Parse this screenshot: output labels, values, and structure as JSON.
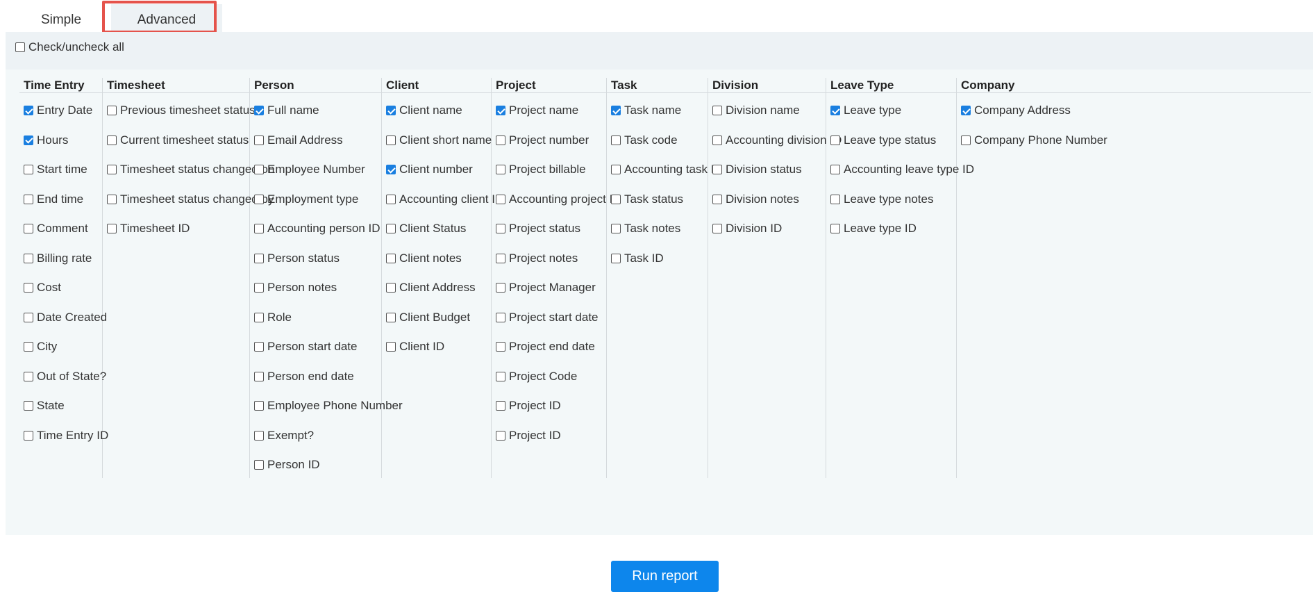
{
  "tabs": {
    "simple": "Simple",
    "advanced": "Advanced"
  },
  "check_all": "Check/uncheck all",
  "columns": [
    {
      "title": "Time Entry",
      "items": [
        {
          "label": "Entry Date",
          "checked": true
        },
        {
          "label": "Hours",
          "checked": true
        },
        {
          "label": "Start time",
          "checked": false
        },
        {
          "label": "End time",
          "checked": false
        },
        {
          "label": "Comment",
          "checked": false
        },
        {
          "label": "Billing rate",
          "checked": false
        },
        {
          "label": "Cost",
          "checked": false
        },
        {
          "label": "Date Created",
          "checked": false
        },
        {
          "label": "City",
          "checked": false
        },
        {
          "label": "Out of State?",
          "checked": false
        },
        {
          "label": "State",
          "checked": false
        },
        {
          "label": "Time Entry ID",
          "checked": false
        }
      ]
    },
    {
      "title": "Timesheet",
      "items": [
        {
          "label": "Previous timesheet status",
          "checked": false
        },
        {
          "label": "Current timesheet status",
          "checked": false
        },
        {
          "label": "Timesheet status changed on",
          "checked": false
        },
        {
          "label": "Timesheet status changed by",
          "checked": false
        },
        {
          "label": "Timesheet ID",
          "checked": false
        }
      ]
    },
    {
      "title": "Person",
      "items": [
        {
          "label": "Full name",
          "checked": true
        },
        {
          "label": "Email Address",
          "checked": false
        },
        {
          "label": "Employee Number",
          "checked": false
        },
        {
          "label": "Employment type",
          "checked": false
        },
        {
          "label": "Accounting person ID",
          "checked": false
        },
        {
          "label": "Person status",
          "checked": false
        },
        {
          "label": "Person notes",
          "checked": false
        },
        {
          "label": "Role",
          "checked": false
        },
        {
          "label": "Person start date",
          "checked": false
        },
        {
          "label": "Person end date",
          "checked": false
        },
        {
          "label": "Employee Phone Number",
          "checked": false
        },
        {
          "label": "Exempt?",
          "checked": false
        },
        {
          "label": "Person ID",
          "checked": false
        }
      ]
    },
    {
      "title": "Client",
      "items": [
        {
          "label": "Client name",
          "checked": true
        },
        {
          "label": "Client short name",
          "checked": false
        },
        {
          "label": "Client number",
          "checked": true
        },
        {
          "label": "Accounting client ID",
          "checked": false
        },
        {
          "label": "Client Status",
          "checked": false
        },
        {
          "label": "Client notes",
          "checked": false
        },
        {
          "label": "Client Address",
          "checked": false
        },
        {
          "label": "Client Budget",
          "checked": false
        },
        {
          "label": "Client ID",
          "checked": false
        }
      ]
    },
    {
      "title": "Project",
      "items": [
        {
          "label": "Project name",
          "checked": true
        },
        {
          "label": "Project number",
          "checked": false
        },
        {
          "label": "Project billable",
          "checked": false
        },
        {
          "label": "Accounting project ID",
          "checked": false
        },
        {
          "label": "Project status",
          "checked": false
        },
        {
          "label": "Project notes",
          "checked": false
        },
        {
          "label": "Project Manager",
          "checked": false
        },
        {
          "label": "Project start date",
          "checked": false
        },
        {
          "label": "Project end date",
          "checked": false
        },
        {
          "label": "Project Code",
          "checked": false
        },
        {
          "label": "Project ID",
          "checked": false
        },
        {
          "label": "Project ID",
          "checked": false
        }
      ]
    },
    {
      "title": "Task",
      "items": [
        {
          "label": "Task name",
          "checked": true
        },
        {
          "label": "Task code",
          "checked": false
        },
        {
          "label": "Accounting task ID",
          "checked": false
        },
        {
          "label": "Task status",
          "checked": false
        },
        {
          "label": "Task notes",
          "checked": false
        },
        {
          "label": "Task ID",
          "checked": false
        }
      ]
    },
    {
      "title": "Division",
      "items": [
        {
          "label": "Division name",
          "checked": false
        },
        {
          "label": "Accounting division ID",
          "checked": false
        },
        {
          "label": "Division status",
          "checked": false
        },
        {
          "label": "Division notes",
          "checked": false
        },
        {
          "label": "Division ID",
          "checked": false
        }
      ]
    },
    {
      "title": "Leave Type",
      "items": [
        {
          "label": "Leave type",
          "checked": true
        },
        {
          "label": "Leave type status",
          "checked": false
        },
        {
          "label": "Accounting leave type ID",
          "checked": false
        },
        {
          "label": "Leave type notes",
          "checked": false
        },
        {
          "label": "Leave type ID",
          "checked": false
        }
      ]
    },
    {
      "title": "Company",
      "items": [
        {
          "label": "Company Address",
          "checked": true
        },
        {
          "label": "Company Phone Number",
          "checked": false
        }
      ]
    }
  ],
  "run_button": "Run report"
}
